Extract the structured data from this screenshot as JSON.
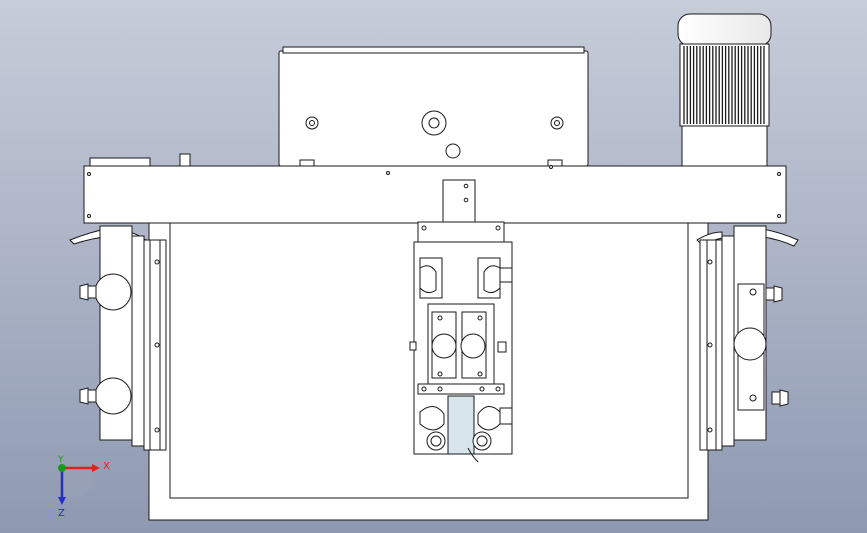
{
  "viewport": {
    "background_top": "#c7ccd9",
    "background_bottom": "#8e99b1",
    "line_color": "#1a1a1a",
    "part_fill": "#ffffff"
  },
  "triad": {
    "x_label": "X",
    "y_label": "Y",
    "z_label": "Z",
    "x_color": "#e0201b",
    "y_color": "#1a9a1a",
    "z_color": "#2030c8"
  }
}
